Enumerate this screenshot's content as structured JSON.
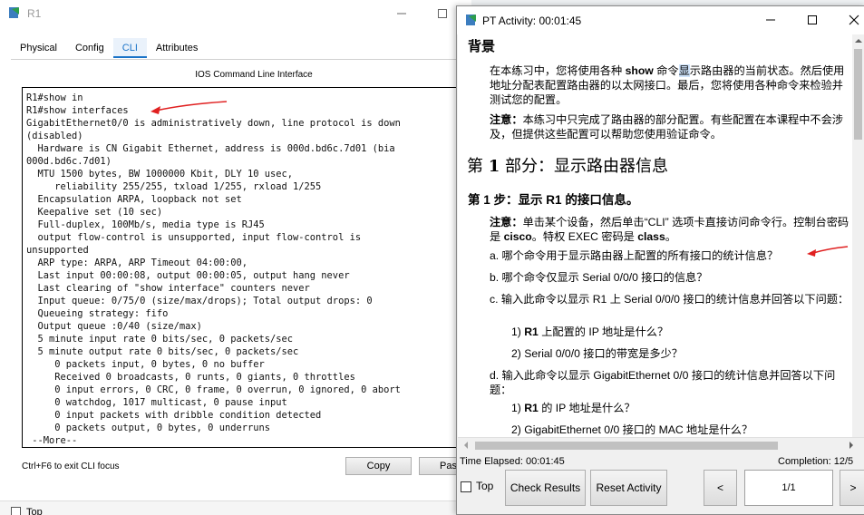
{
  "r1": {
    "title": "R1",
    "tabs": [
      "Physical",
      "Config",
      "CLI",
      "Attributes"
    ],
    "active_tab": "CLI",
    "cli_heading": "IOS Command Line Interface",
    "cli_lines": [
      "R1#show in",
      "R1#show interfaces",
      "GigabitEthernet0/0 is administratively down, line protocol is down",
      "(disabled)",
      "  Hardware is CN Gigabit Ethernet, address is 000d.bd6c.7d01 (bia",
      "000d.bd6c.7d01)",
      "  MTU 1500 bytes, BW 1000000 Kbit, DLY 10 usec,",
      "     reliability 255/255, txload 1/255, rxload 1/255",
      "  Encapsulation ARPA, loopback not set",
      "  Keepalive set (10 sec)",
      "  Full-duplex, 100Mb/s, media type is RJ45",
      "  output flow-control is unsupported, input flow-control is",
      "unsupported",
      "  ARP type: ARPA, ARP Timeout 04:00:00,",
      "  Last input 00:00:08, output 00:00:05, output hang never",
      "  Last clearing of \"show interface\" counters never",
      "  Input queue: 0/75/0 (size/max/drops); Total output drops: 0",
      "  Queueing strategy: fifo",
      "  Output queue :0/40 (size/max)",
      "  5 minute input rate 0 bits/sec, 0 packets/sec",
      "  5 minute output rate 0 bits/sec, 0 packets/sec",
      "     0 packets input, 0 bytes, 0 no buffer",
      "     Received 0 broadcasts, 0 runts, 0 giants, 0 throttles",
      "     0 input errors, 0 CRC, 0 frame, 0 overrun, 0 ignored, 0 abort",
      "     0 watchdog, 1017 multicast, 0 pause input",
      "     0 input packets with dribble condition detected",
      "     0 packets output, 0 bytes, 0 underruns",
      " --More--"
    ],
    "cli_hint": "Ctrl+F6 to exit CLI focus",
    "copy_label": "Copy",
    "paste_label": "Pas",
    "top_label": "Top"
  },
  "pt": {
    "title": "PT Activity: 00:01:45",
    "heading_background": "背景",
    "bg_para_1a": "在本练习中，您将使用各种 ",
    "bg_para_1_bold": "show",
    "bg_para_1b": " 命令",
    "bg_para_1_hl": "显",
    "bg_para_1c": "示路由器的当前状态。然后使用 地址分配表配置路由器的以太网接口。最后，您将使用各种命令来检验并测试您的配置。",
    "note_label": "注意：",
    "note_text": "本练习中只完成了路由器的部分配置。有些配置在本课程中不会涉及，但提供这些配置可以帮助您使用验证命令。",
    "part_heading_a": "第 ",
    "part_heading_num": "1",
    "part_heading_b": " 部分：显示路由器信息",
    "step_heading_a": "第 ",
    "step_heading_num": "1",
    "step_heading_b": " 步：显示 ",
    "step_heading_r1": "R1",
    "step_heading_c": " 的接口信息。",
    "step_note_label": "注意：",
    "step_note_a": "单击某个设备，然后单击“CLI” 选项卡直接访问命令行。控制台密码是 ",
    "step_note_cisco": "cisco",
    "step_note_b": "。特权 EXEC 密码是 ",
    "step_note_class": "class",
    "step_note_c": "。",
    "q_a": "a.  哪个命令用于显示路由器上配置的所有接口的统计信息？",
    "q_b": "b.  哪个命令仅显示 Serial 0/0/0 接口的信息？",
    "q_c": "c.  输入此命令以显示 R1 上 Serial 0/0/0 接口的统计信息并回答以下问题：",
    "q_c1_a": "1)  ",
    "q_c1_r1": "R1",
    "q_c1_b": " 上配置的 IP 地址是什么？",
    "q_c2": "2)  Serial 0/0/0 接口的带宽是多少？",
    "q_d": "d.  输入此命令以显示 GigabitEthernet 0/0 接口的统计信息并回答以下问题：",
    "q_d1_a": "1)  ",
    "q_d1_r1": "R1",
    "q_d1_b": " 的 IP 地址是什么？",
    "q_d2": "2)  GigabitEthernet 0/0 接口的 MAC 地址是什么？",
    "time_elapsed": "Time Elapsed: 00:01:45",
    "completion": "Completion: 12/5",
    "top_label": "Top",
    "check_results": "Check Results",
    "reset_activity": "Reset Activity",
    "prev": "<",
    "page": "1/1",
    "next": ">"
  },
  "colors": {
    "accent": "#1a73c8",
    "arrow": "#e02020"
  }
}
